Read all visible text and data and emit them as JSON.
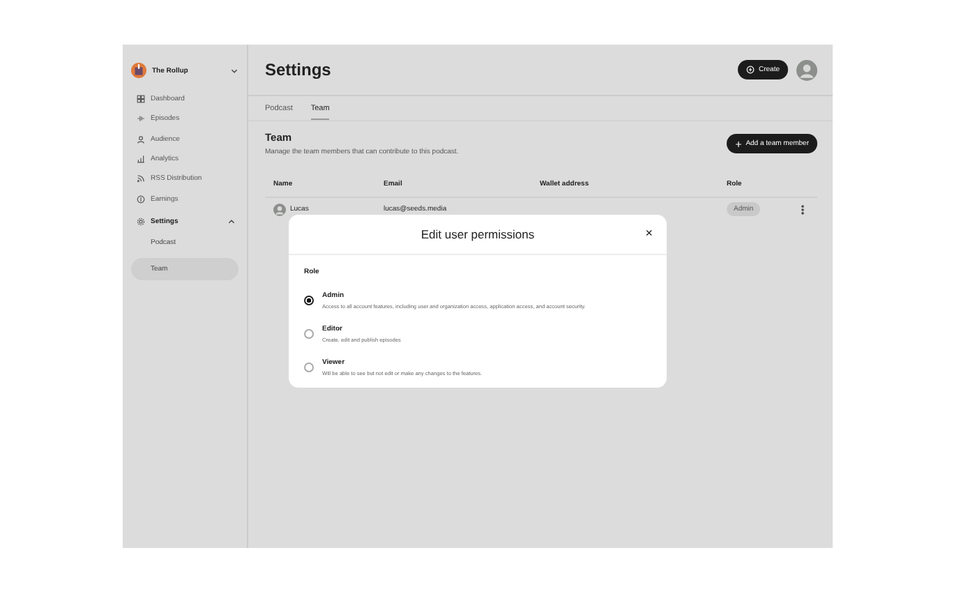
{
  "workspace": {
    "name": "The Rollup"
  },
  "sidebar": {
    "items": [
      {
        "label": "Dashboard",
        "selected": false
      },
      {
        "label": "Episodes",
        "selected": false
      },
      {
        "label": "Audience",
        "selected": false
      },
      {
        "label": "Analytics",
        "selected": false
      },
      {
        "label": "RSS Distribution",
        "selected": false
      },
      {
        "label": "Earnings",
        "selected": false
      },
      {
        "label": "Settings",
        "selected": false,
        "expanded": true,
        "children": [
          {
            "label": "Podcast",
            "selected": false
          },
          {
            "label": "Team",
            "selected": true
          }
        ]
      }
    ]
  },
  "header": {
    "title": "Settings",
    "create_button": "Create"
  },
  "tabs": [
    {
      "label": "Podcast",
      "selected": false
    },
    {
      "label": "Team",
      "selected": true
    }
  ],
  "section": {
    "title": "Team",
    "description": "Manage the team members that can contribute to this podcast.",
    "add_button": "Add a team member"
  },
  "table": {
    "columns": [
      "Name",
      "Email",
      "Wallet address",
      "Role"
    ],
    "rows": [
      {
        "name": "Lucas",
        "email": "lucas@seeds.media",
        "role": "Admin"
      }
    ]
  },
  "modal": {
    "title": "Edit user permissions",
    "close": "×",
    "field_label": "Role",
    "options": [
      {
        "label": "Admin",
        "description": "Access to all account features, including user and organization access, application access, and account security.",
        "selected": true
      },
      {
        "label": "Editor",
        "description": "Create, edit and publish episodes",
        "selected": false
      },
      {
        "label": "Viewer",
        "description": "Will be able to see but not edit or make any changes to the features.",
        "selected": false
      }
    ]
  }
}
